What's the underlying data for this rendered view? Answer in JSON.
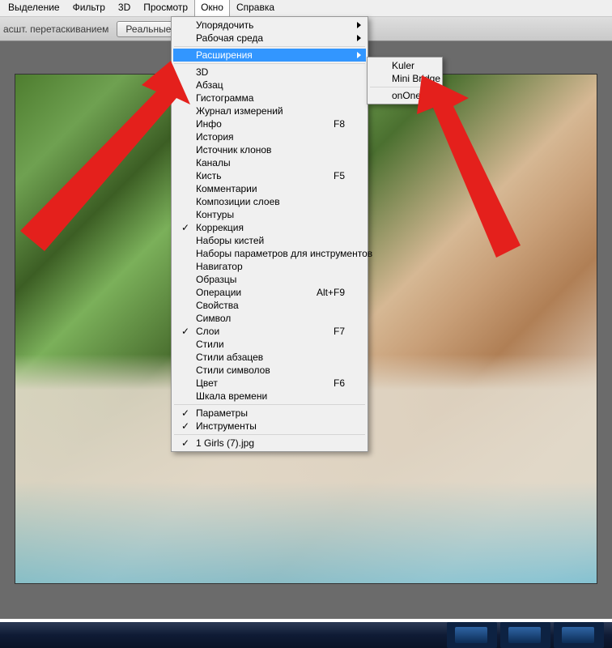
{
  "menubar": {
    "items": [
      {
        "label": "Выделение"
      },
      {
        "label": "Фильтр"
      },
      {
        "label": "3D"
      },
      {
        "label": "Просмотр"
      },
      {
        "label": "Окно",
        "open": true
      },
      {
        "label": "Справка"
      }
    ]
  },
  "toolbar": {
    "drag_label": "асшт. перетаскиванием",
    "real_pixels": "Реальные пикселы"
  },
  "window_menu": {
    "rows": [
      {
        "label": "Упорядочить",
        "submenu": true
      },
      {
        "label": "Рабочая среда",
        "submenu": true
      },
      {
        "sep": true
      },
      {
        "label": "Расширения",
        "submenu": true,
        "selected": true
      },
      {
        "sep": true
      },
      {
        "label": "3D"
      },
      {
        "label": "Абзац"
      },
      {
        "label": "Гистограмма"
      },
      {
        "label": "Журнал измерений"
      },
      {
        "label": "Инфо",
        "shortcut": "F8"
      },
      {
        "label": "История"
      },
      {
        "label": "Источник клонов"
      },
      {
        "label": "Каналы"
      },
      {
        "label": "Кисть",
        "shortcut": "F5"
      },
      {
        "label": "Комментарии"
      },
      {
        "label": "Композиции слоев"
      },
      {
        "label": "Контуры"
      },
      {
        "label": "Коррекция",
        "checked": true
      },
      {
        "label": "Наборы кистей"
      },
      {
        "label": "Наборы параметров для инструментов"
      },
      {
        "label": "Навигатор"
      },
      {
        "label": "Образцы"
      },
      {
        "label": "Операции",
        "shortcut": "Alt+F9"
      },
      {
        "label": "Свойства"
      },
      {
        "label": "Символ"
      },
      {
        "label": "Слои",
        "shortcut": "F7",
        "checked": true
      },
      {
        "label": "Стили"
      },
      {
        "label": "Стили абзацев"
      },
      {
        "label": "Стили символов"
      },
      {
        "label": "Цвет",
        "shortcut": "F6"
      },
      {
        "label": "Шкала времени"
      },
      {
        "sep": true
      },
      {
        "label": "Параметры",
        "checked": true
      },
      {
        "label": "Инструменты",
        "checked": true
      },
      {
        "sep": true
      },
      {
        "label": "1 Girls (7).jpg",
        "checked": true
      }
    ]
  },
  "ext_submenu": {
    "rows": [
      {
        "label": "Kuler"
      },
      {
        "label": "Mini Bridge"
      },
      {
        "sep": true
      },
      {
        "label": "onOne"
      }
    ]
  }
}
